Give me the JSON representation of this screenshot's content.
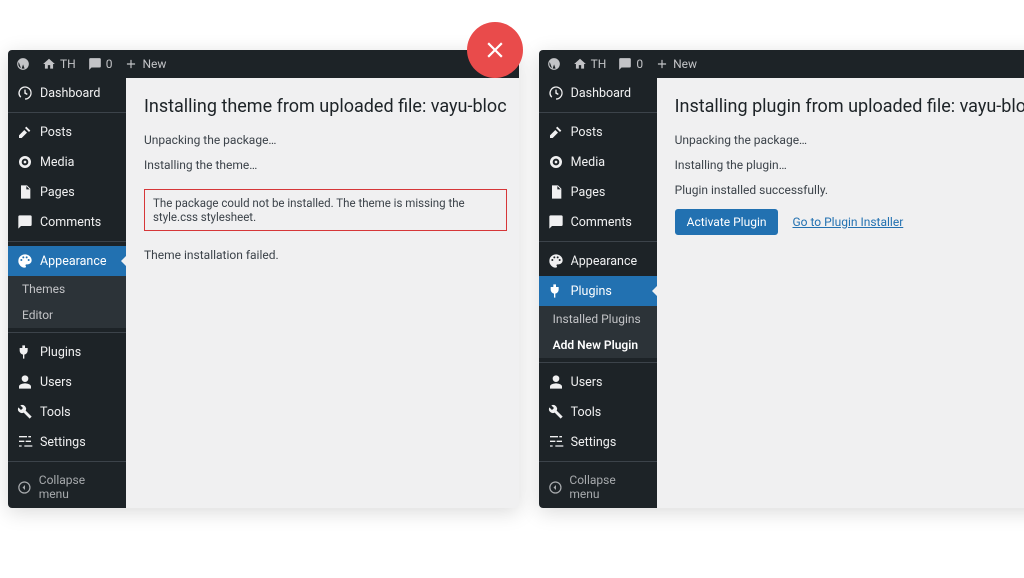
{
  "badges": {
    "bad": "✕",
    "good": "✓"
  },
  "adminbar": {
    "site": "TH",
    "comments": "0",
    "new": "New"
  },
  "sidebar_common": {
    "dashboard": "Dashboard",
    "posts": "Posts",
    "media": "Media",
    "pages": "Pages",
    "comments": "Comments",
    "appearance": "Appearance",
    "plugins": "Plugins",
    "users": "Users",
    "tools": "Tools",
    "settings": "Settings",
    "collapse": "Collapse menu"
  },
  "left": {
    "submenu": {
      "themes": "Themes",
      "editor": "Editor"
    },
    "title": "Installing theme from uploaded file: vayu-bloc",
    "line1": "Unpacking the package…",
    "line2": "Installing the theme…",
    "error": "The package could not be installed. The theme is missing the style.css stylesheet.",
    "line3": "Theme installation failed."
  },
  "right": {
    "submenu": {
      "installed": "Installed Plugins",
      "addnew": "Add New Plugin"
    },
    "title": "Installing plugin from uploaded file: vayu-blocks.z",
    "line1": "Unpacking the package…",
    "line2": "Installing the plugin…",
    "line3": "Plugin installed successfully.",
    "activate": "Activate Plugin",
    "goto": "Go to Plugin Installer"
  }
}
